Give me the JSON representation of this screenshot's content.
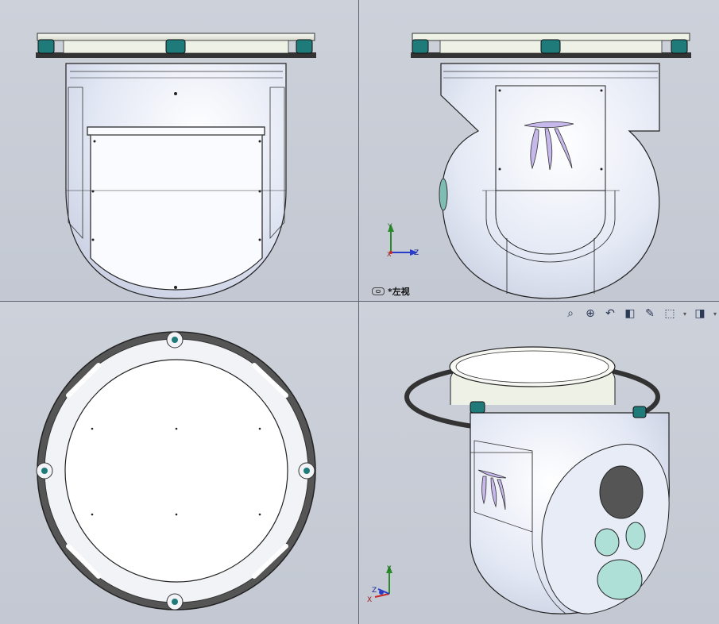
{
  "views": {
    "left_view_label": "*左视"
  },
  "triad": {
    "left": {
      "x": "X",
      "y": "Y",
      "z": "Z"
    },
    "iso": {
      "x": "X",
      "y": "Y",
      "z": "Z"
    }
  },
  "toolbar": {
    "icons": [
      "zoom-to-fit-icon",
      "zoom-area-icon",
      "previous-view-icon",
      "section-view-icon",
      "dynamic-annotation-icon",
      "view-orientation-icon",
      "display-style-icon"
    ]
  },
  "colors": {
    "background": "#c9cdd6",
    "body": "#e6ebf6",
    "flange_teal": "#2a8a8a",
    "ring_dark": "#555555",
    "window_green": "#aee0d8",
    "logo_purple": "#c6b8ea"
  }
}
